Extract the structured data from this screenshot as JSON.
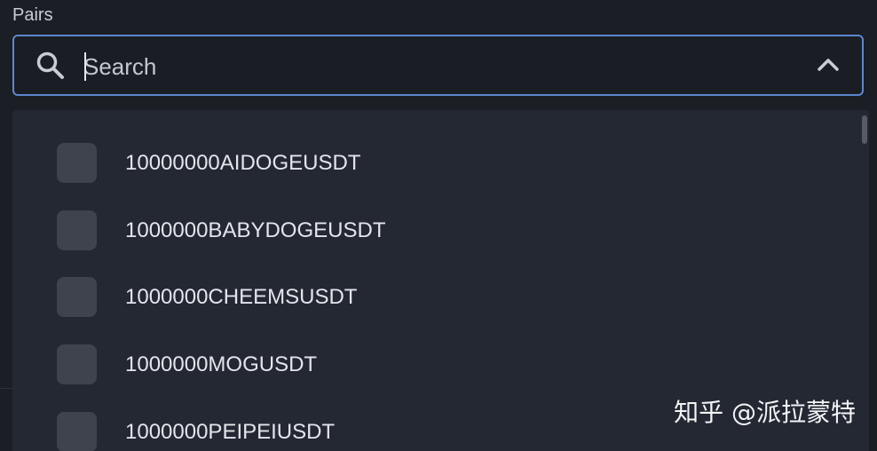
{
  "field": {
    "label": "Pairs"
  },
  "search": {
    "placeholder": "Search",
    "value": "",
    "icon": "search-icon",
    "toggle_icon": "chevron-up-icon"
  },
  "colors": {
    "focus_border": "#5b87cf",
    "background": "#1b1e25",
    "dropdown_background": "#242833",
    "checkbox": "#3f434e"
  },
  "options": [
    {
      "label": "10000000AIDOGEUSDT",
      "checked": false
    },
    {
      "label": "1000000BABYDOGEUSDT",
      "checked": false
    },
    {
      "label": "1000000CHEEMSUSDT",
      "checked": false
    },
    {
      "label": "1000000MOGUSDT",
      "checked": false
    },
    {
      "label": "1000000PEIPEIUSDT",
      "checked": false
    }
  ],
  "watermark": {
    "text": "知乎 @派拉蒙特"
  }
}
